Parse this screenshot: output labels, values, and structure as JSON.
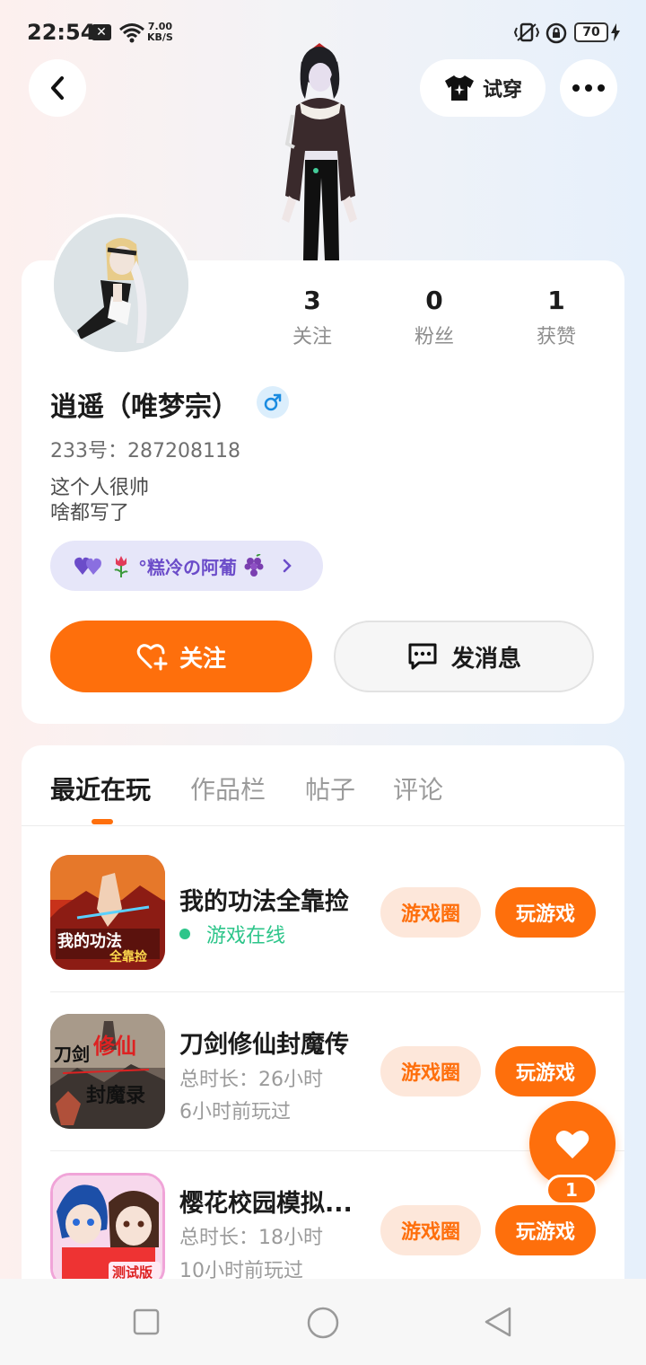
{
  "status_bar": {
    "time": "22:54",
    "notification_icon": "x-icon",
    "net_speed_value": "7.00",
    "net_speed_unit": "KB/S",
    "battery": "70"
  },
  "header": {
    "tryon_label": "试穿"
  },
  "profile": {
    "stats": [
      {
        "value": "3",
        "label": "关注"
      },
      {
        "value": "0",
        "label": "粉丝"
      },
      {
        "value": "1",
        "label": "获赞"
      }
    ],
    "username": "逍遥（唯梦宗）",
    "gender": "male",
    "uid": "233号：287208118",
    "bio_line1": "这个人很帅",
    "bio_line2": "啥都写了",
    "badge_text": "°糕冷の阿葡",
    "follow_label": "关注",
    "message_label": "发消息"
  },
  "tabs": [
    "最近在玩",
    "作品栏",
    "帖子",
    "评论"
  ],
  "games": [
    {
      "name": "我的功法全靠捡",
      "status": "游戏在线",
      "circle_label": "游戏圈",
      "play_label": "玩游戏"
    },
    {
      "name": "刀剑修仙封魔传",
      "duration": "总时长：26小时",
      "last_played": "6小时前玩过",
      "circle_label": "游戏圈",
      "play_label": "玩游戏"
    },
    {
      "name": "樱花校园模拟...",
      "duration": "总时长：18小时",
      "last_played": "10小时前玩过",
      "circle_label": "游戏圈",
      "play_label": "玩游戏"
    }
  ],
  "like_fab": {
    "count": "1"
  },
  "colors": {
    "accent": "#fe6f0c",
    "online": "#2dc58a",
    "badge_text": "#6b4cc9"
  }
}
